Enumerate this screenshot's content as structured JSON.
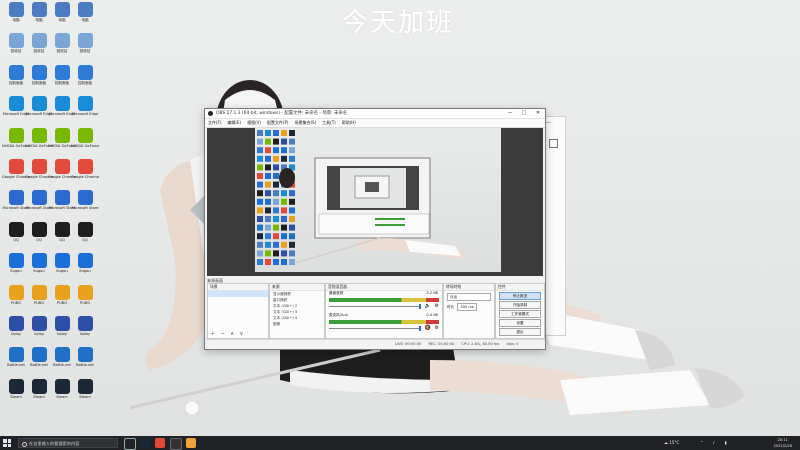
{
  "wallpaper": {
    "title": "今天加班"
  },
  "desktop": {
    "icons": [
      {
        "label": "电脑",
        "color": "#4b7cc2"
      },
      {
        "label": "回收站",
        "color": "#7aa6d6"
      },
      {
        "label": "控制面板",
        "color": "#2f7bd8"
      },
      {
        "label": "Microsoft Edge",
        "color": "#1a8bd6"
      },
      {
        "label": "NVIDIA GeForce Experience",
        "color": "#76b900"
      },
      {
        "label": "Google Chrome",
        "color": "#e24b3a"
      },
      {
        "label": "Microsoft Store",
        "color": "#2b6bd1"
      },
      {
        "label": "QQ",
        "color": "#1e1e1e"
      },
      {
        "label": "Kugou",
        "color": "#1a6fd8"
      },
      {
        "label": "PUBG",
        "color": "#e8a21c"
      },
      {
        "label": "Uplay",
        "color": "#2d4fa8"
      },
      {
        "label": "Battle.net",
        "color": "#2070c8"
      },
      {
        "label": "Steam",
        "color": "#1b2838"
      }
    ]
  },
  "obs": {
    "title": "OBS 27.1.3 (64-bit, windows) - 配置文件: 未命名 - 场景: 未命名",
    "menu": [
      "文件(F)",
      "编辑(E)",
      "视图(V)",
      "配置文件(P)",
      "场景集合(S)",
      "工具(T)",
      "帮助(H)"
    ],
    "scene_label": "来源画面",
    "scenes_header": "场景",
    "sources_header": "来源",
    "sources": [
      "显示器捕获",
      "窗口捕获",
      "文本 (GDI+) 2",
      "文本 (GDI+) 3",
      "文本 (GDI+) 4",
      "图像"
    ],
    "mixer_header": "音频混音器",
    "mixer": [
      {
        "name": "桌面音频",
        "db": "-3.2 dB"
      },
      {
        "name": "麦克风/Aux",
        "db": "0.0 dB"
      }
    ],
    "transitions_header": "转场特效",
    "transition_type": "淡出",
    "transition_duration_label": "时长",
    "transition_duration": "300 ms",
    "controls_header": "控件",
    "controls": [
      "停止推流",
      "开始录制",
      "工作室模式",
      "设置",
      "退出"
    ],
    "status": {
      "live": "LIVE: 00:00:00",
      "rec": "REC: 00:00:00",
      "cpu": "CPU: 2.8%, 60.00 fps",
      "kbps": "kb/s: 0"
    }
  },
  "taskbar": {
    "search_placeholder": "在这里输入你要搜索的内容",
    "weather": "15°C",
    "time": "20:11",
    "date": "2022/2/28"
  }
}
